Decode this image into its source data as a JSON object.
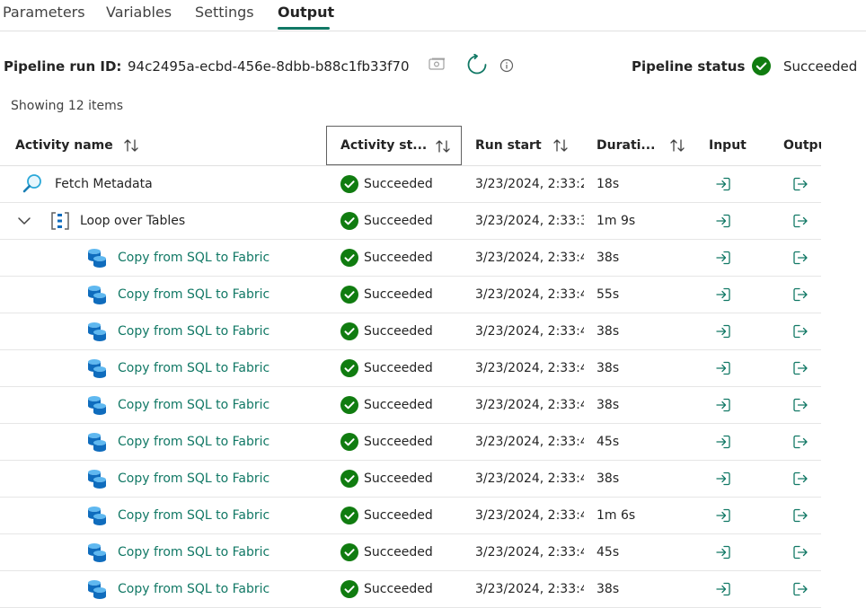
{
  "tabs": [
    {
      "label": "Parameters"
    },
    {
      "label": "Variables"
    },
    {
      "label": "Settings"
    },
    {
      "label": "Output"
    }
  ],
  "run": {
    "label": "Pipeline run ID:",
    "id": "94c2495a-ecbd-456e-8dbb-b88c1fb33f70",
    "status_label": "Pipeline status",
    "status_value": "Succeeded"
  },
  "showing": "Showing 12 items",
  "columns": {
    "name": "Activity name",
    "status": "Activity st...",
    "start": "Run start",
    "duration": "Durati...",
    "input": "Input",
    "output": "Outpu"
  },
  "rows": [
    {
      "name": "Fetch Metadata",
      "status": "Succeeded",
      "start": "3/23/2024, 2:33:2",
      "duration": "18s"
    },
    {
      "name": "Loop over Tables",
      "status": "Succeeded",
      "start": "3/23/2024, 2:33:3",
      "duration": "1m 9s"
    },
    {
      "name": "Copy from SQL to Fabric",
      "status": "Succeeded",
      "start": "3/23/2024, 2:33:4",
      "duration": "38s"
    },
    {
      "name": "Copy from SQL to Fabric",
      "status": "Succeeded",
      "start": "3/23/2024, 2:33:4",
      "duration": "55s"
    },
    {
      "name": "Copy from SQL to Fabric",
      "status": "Succeeded",
      "start": "3/23/2024, 2:33:4",
      "duration": "38s"
    },
    {
      "name": "Copy from SQL to Fabric",
      "status": "Succeeded",
      "start": "3/23/2024, 2:33:4",
      "duration": "38s"
    },
    {
      "name": "Copy from SQL to Fabric",
      "status": "Succeeded",
      "start": "3/23/2024, 2:33:4",
      "duration": "38s"
    },
    {
      "name": "Copy from SQL to Fabric",
      "status": "Succeeded",
      "start": "3/23/2024, 2:33:4",
      "duration": "45s"
    },
    {
      "name": "Copy from SQL to Fabric",
      "status": "Succeeded",
      "start": "3/23/2024, 2:33:4",
      "duration": "38s"
    },
    {
      "name": "Copy from SQL to Fabric",
      "status": "Succeeded",
      "start": "3/23/2024, 2:33:4",
      "duration": "1m 6s"
    },
    {
      "name": "Copy from SQL to Fabric",
      "status": "Succeeded",
      "start": "3/23/2024, 2:33:4",
      "duration": "45s"
    },
    {
      "name": "Copy from SQL to Fabric",
      "status": "Succeeded",
      "start": "3/23/2024, 2:33:4",
      "duration": "38s"
    }
  ],
  "colors": {
    "accent": "#117865",
    "success": "#107c10",
    "copy_icon": "#0f6cbd"
  }
}
